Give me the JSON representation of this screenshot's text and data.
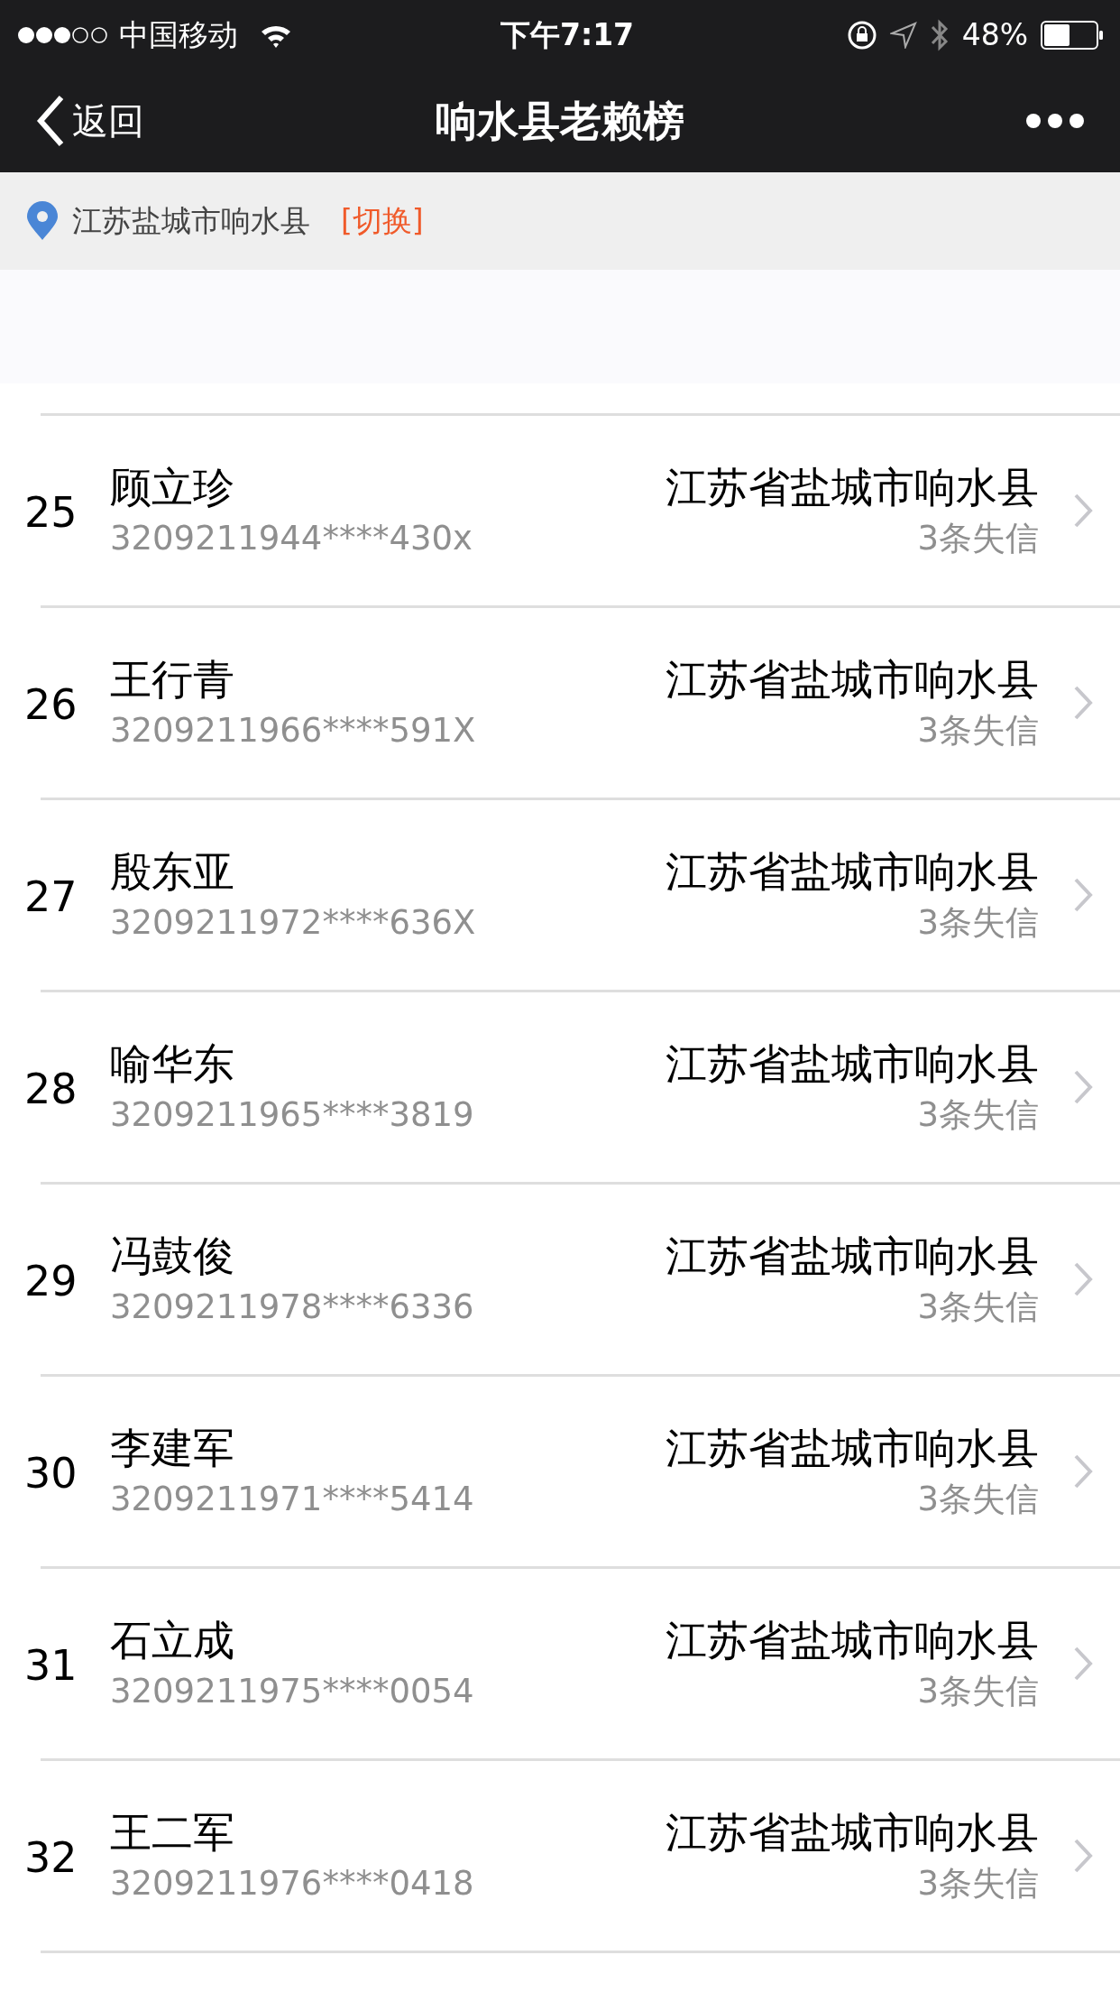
{
  "status_bar": {
    "carrier": "中国移动",
    "time": "下午7:17",
    "battery": "48%"
  },
  "nav": {
    "back": "返回",
    "title": "响水县老赖榜"
  },
  "location": {
    "text": "江苏盐城市响水县",
    "switch": "[切换]"
  },
  "rows": [
    {
      "rank": "25",
      "name": "顾立珍",
      "id": "3209211944****430x",
      "region": "江苏省盐城市响水县",
      "count": "3条失信"
    },
    {
      "rank": "26",
      "name": "王行青",
      "id": "3209211966****591X",
      "region": "江苏省盐城市响水县",
      "count": "3条失信"
    },
    {
      "rank": "27",
      "name": "殷东亚",
      "id": "3209211972****636X",
      "region": "江苏省盐城市响水县",
      "count": "3条失信"
    },
    {
      "rank": "28",
      "name": "喻华东",
      "id": "3209211965****3819",
      "region": "江苏省盐城市响水县",
      "count": "3条失信"
    },
    {
      "rank": "29",
      "name": "冯鼓俊",
      "id": "3209211978****6336",
      "region": "江苏省盐城市响水县",
      "count": "3条失信"
    },
    {
      "rank": "30",
      "name": "李建军",
      "id": "3209211971****5414",
      "region": "江苏省盐城市响水县",
      "count": "3条失信"
    },
    {
      "rank": "31",
      "name": "石立成",
      "id": "3209211975****0054",
      "region": "江苏省盐城市响水县",
      "count": "3条失信"
    },
    {
      "rank": "32",
      "name": "王二军",
      "id": "3209211976****0418",
      "region": "江苏省盐城市响水县",
      "count": "3条失信"
    }
  ]
}
